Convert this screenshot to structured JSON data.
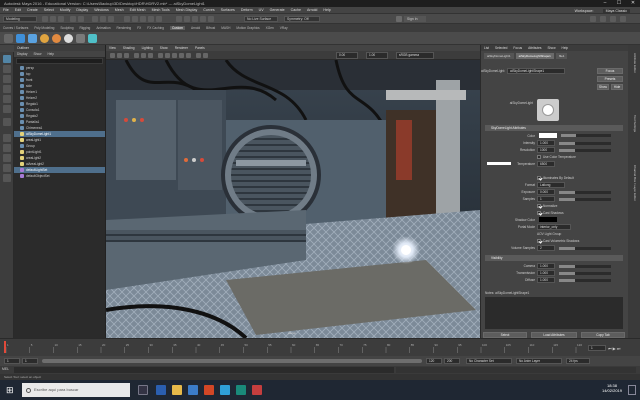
{
  "window": {
    "title": "Autodesk Maya 2016 - Educational Version: C:\\Users\\Backup\\3D\\Desktop\\HDR\\HDRV2.mb* --- aiSkyDomeLight1"
  },
  "menubar": {
    "items": [
      "File",
      "Edit",
      "Create",
      "Select",
      "Modify",
      "Display",
      "Windows",
      "Mesh",
      "Edit Mesh",
      "Mesh Tools",
      "Mesh Display",
      "Curves",
      "Surfaces",
      "Deform",
      "UV",
      "Generate",
      "Cache",
      "Arnold",
      "Help"
    ],
    "workspace_label": "Workspace:",
    "workspace_value": "Maya Classic"
  },
  "statusline": {
    "mode": "Modeling",
    "camera_field": "No Live Surface",
    "symmetry": "Symmetry: Off",
    "signin": "Sign In"
  },
  "shelf": {
    "tabs": [
      "Curves / Surfaces",
      "Poly Modeling",
      "Sculpting",
      "Rigging",
      "Animation",
      "Rendering",
      "FX",
      "FX Caching",
      "Custom",
      "Arnold",
      "Bifrost",
      "MASH",
      "Motion Graphics",
      "XGen",
      "VRay"
    ],
    "active_tab": "Custom"
  },
  "outliner": {
    "title": "Outliner",
    "menu": [
      "Display",
      "Show",
      "Help"
    ],
    "items": [
      {
        "label": "persp",
        "type": "cam",
        "selected": false
      },
      {
        "label": "top",
        "type": "cam",
        "selected": false
      },
      {
        "label": "front",
        "type": "cam",
        "selected": false
      },
      {
        "label": "side",
        "type": "cam",
        "selected": false
      },
      {
        "label": "Heizer1",
        "type": "mesh",
        "selected": false
      },
      {
        "label": "Heizer2",
        "type": "mesh",
        "selected": false
      },
      {
        "label": "Regalo1",
        "type": "mesh",
        "selected": false
      },
      {
        "label": "Consola1",
        "type": "mesh",
        "selected": false
      },
      {
        "label": "Regalo2",
        "type": "mesh",
        "selected": false
      },
      {
        "label": "Pantalla1",
        "type": "mesh",
        "selected": false
      },
      {
        "label": "Chimenea1",
        "type": "mesh",
        "selected": false
      },
      {
        "label": "aiSkyDomeLight1",
        "type": "light",
        "selected": true
      },
      {
        "label": "areaLight1",
        "type": "light",
        "selected": false
      },
      {
        "label": "Group",
        "type": "mesh",
        "selected": false
      },
      {
        "label": "pointLight1",
        "type": "light",
        "selected": false
      },
      {
        "label": "areaLight2",
        "type": "light",
        "selected": false
      },
      {
        "label": "aiAreaLight2",
        "type": "light",
        "selected": false
      },
      {
        "label": "defaultLightSet",
        "type": "set",
        "selected": true
      },
      {
        "label": "defaultObjectSet",
        "type": "set",
        "selected": false
      }
    ]
  },
  "viewport": {
    "menu": [
      "View",
      "Shading",
      "Lighting",
      "Show",
      "Renderer",
      "Panels"
    ],
    "camera_label": "persp",
    "field_a": "0.00",
    "field_b": "1.00",
    "colorspace": "sRGB gamma"
  },
  "attribute_editor": {
    "menu": [
      "List",
      "Selected",
      "Focus",
      "Attributes",
      "Show",
      "Help"
    ],
    "tabs": [
      "aiSkyDomeLight1",
      "aiSkyDomeLightShape1",
      "file1"
    ],
    "active_tab": "aiSkyDomeLightShape1",
    "node_label": "aiSkyDomeLight:",
    "node_value": "aiSkyDomeLightShape1",
    "focus_btn": "Focus",
    "presets_btn": "Presets",
    "show_btn": "Show",
    "hide_btn": "Hide",
    "swatch_caption": "aiSkyDomeLight",
    "sections": {
      "main": "SkyDomeLight Attributes",
      "visibility": "Visibility"
    },
    "attrs": {
      "color": "Color",
      "intensity": "Intensity",
      "intensity_val": "1.000",
      "resolution": "Resolution",
      "resolution_val": "1000",
      "use_color_temp": "Use Color Temperature",
      "temperature": "Temperature",
      "temperature_val": "6500",
      "emit_diffuse": "Emit Diffuse",
      "emit_specular": "Emit Specular",
      "illuminates_default": "Illuminates By Default",
      "format": "Format",
      "format_val": "Latlong",
      "exposure": "Exposure",
      "exposure_val": "0.000",
      "samples": "Samples",
      "samples_val": "1",
      "normalize": "Normalize",
      "cast_shadows": "Cast Shadows",
      "shadow_color": "Shadow Color",
      "portal_mode": "Portal Mode",
      "portal_val": "interior_only",
      "aov_label": "AOV Light Group",
      "cast_vol_shadows": "Cast Volumetric Shadows",
      "volume_samples": "Volume Samples",
      "volume_samples_val": "2",
      "camera": "Camera",
      "camera_val": "1.000",
      "transmission": "Transmission",
      "transmission_val": "1.000",
      "diffuse": "Diffuse",
      "diffuse_val": "1.000"
    },
    "notes_label": "Notes: aiSkyDomeLightShape1",
    "buttons": [
      "Select",
      "Load Attributes",
      "Copy Tab"
    ]
  },
  "sidestrip": {
    "labels": [
      "Attribute Editor",
      "Tool Settings",
      "Channel Box / Layer Editor"
    ]
  },
  "timeline": {
    "ticks": [
      "1",
      "5",
      "10",
      "15",
      "20",
      "25",
      "30",
      "35",
      "40",
      "45",
      "50",
      "55",
      "60",
      "65",
      "70",
      "75",
      "80",
      "85",
      "90",
      "95",
      "100",
      "105",
      "110",
      "115",
      "120"
    ],
    "current_frame": "1",
    "start": "1",
    "end": "120",
    "range_start": "1",
    "range_end": "120",
    "max": "200",
    "no_char_set": "No Character Set",
    "no_anim_layer": "No Anim Layer",
    "fps": "24 fps"
  },
  "cmdline": {
    "mel": "MEL"
  },
  "helpline": {
    "text": "Select Tool: select an object"
  },
  "taskbar": {
    "search_placeholder": "Escribe aquí para buscar",
    "time": "18:38",
    "date": "14/02/2019"
  },
  "colors": {
    "accent": "#5285a6",
    "selection": "#4f6f8c",
    "panel": "#444444",
    "dark": "#2b2b2b"
  }
}
